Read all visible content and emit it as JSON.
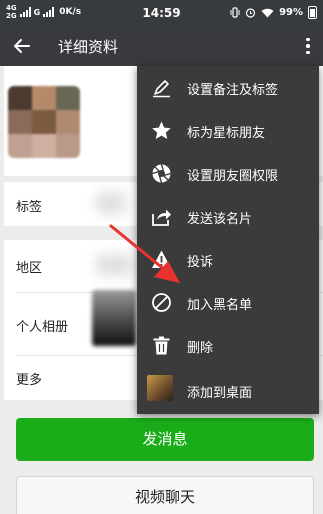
{
  "status_bar": {
    "net_top": "4G",
    "net_bottom": "2G",
    "carrier_mark": "G",
    "speed": "0K/s",
    "time": "14:59",
    "battery": "99%"
  },
  "title_bar": {
    "title": "详细资料"
  },
  "profile": {
    "rows": {
      "tag_label": "标签",
      "region_label": "地区",
      "album_label": "个人相册",
      "more_label": "更多"
    }
  },
  "menu": {
    "items": [
      {
        "label": "设置备注及标签",
        "icon": "pencil-icon"
      },
      {
        "label": "标为星标朋友",
        "icon": "star-icon"
      },
      {
        "label": "设置朋友圈权限",
        "icon": "aperture-icon"
      },
      {
        "label": "发送该名片",
        "icon": "share-icon"
      },
      {
        "label": "投诉",
        "icon": "warning-icon"
      },
      {
        "label": "加入黑名单",
        "icon": "block-icon"
      },
      {
        "label": "删除",
        "icon": "trash-icon"
      },
      {
        "label": "添加到桌面",
        "icon": "thumbnail-icon"
      }
    ]
  },
  "buttons": {
    "send_message": "发消息",
    "video_call": "视频聊天"
  },
  "colors": {
    "status_bar": "#383b3e",
    "title_bar": "#393a3f",
    "menu_bg": "#3b3b3b",
    "primary_green": "#1aad19",
    "annotation_red": "#e8322f"
  }
}
